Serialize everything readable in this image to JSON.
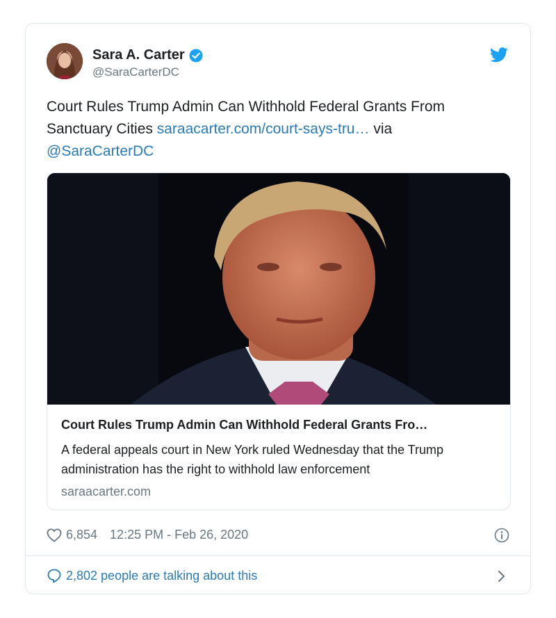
{
  "author": {
    "name": "Sara A. Carter",
    "handle": "@SaraCarterDC",
    "verified": true
  },
  "tweet": {
    "text_before": "Court Rules Trump Admin Can Withhold Federal Grants From Sanctuary Cities ",
    "link_text": "saraacarter.com/court-says-tru…",
    "text_via": " via ",
    "mention": "@SaraCarterDC"
  },
  "card": {
    "title": "Court Rules Trump Admin Can Withhold Federal Grants Fro…",
    "description": "A federal appeals court in New York ruled Wednesday that the Trump administration has the right to withhold law enforcement",
    "domain": "saraacarter.com"
  },
  "meta": {
    "likes": "6,854",
    "timestamp": "12:25 PM - Feb 26, 2020"
  },
  "footer": {
    "talking": "2,802 people are talking about this"
  },
  "colors": {
    "link": "#2b7bb9",
    "muted": "#697882",
    "twitter_blue": "#1da1f2"
  },
  "icons": [
    "verified-badge-icon",
    "twitter-bird-icon",
    "heart-icon",
    "info-icon",
    "speech-bubble-icon",
    "chevron-right-icon"
  ]
}
